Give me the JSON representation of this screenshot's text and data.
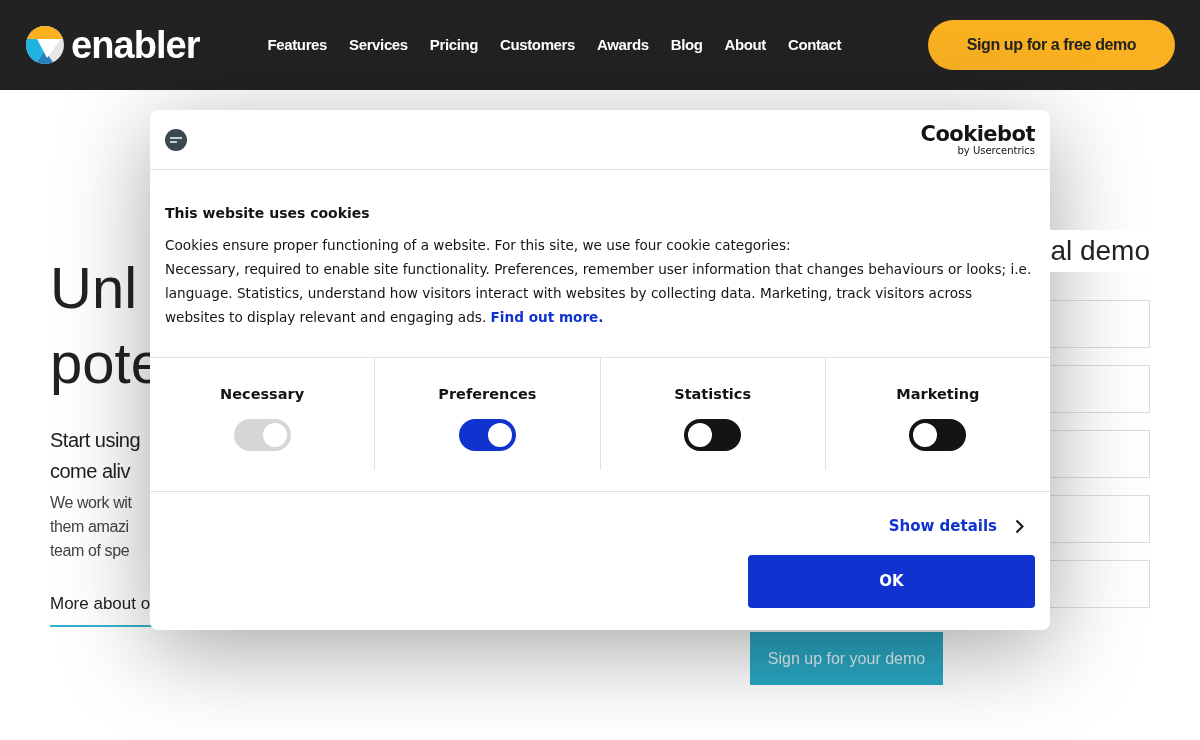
{
  "header": {
    "brand": "enabler",
    "nav": [
      {
        "label": "Features"
      },
      {
        "label": "Services"
      },
      {
        "label": "Pricing"
      },
      {
        "label": "Customers"
      },
      {
        "label": "Awards"
      },
      {
        "label": "Blog"
      },
      {
        "label": "About"
      },
      {
        "label": "Contact"
      }
    ],
    "cta": "Sign up for a free demo"
  },
  "page": {
    "headline_lines": [
      "Unl",
      "pote"
    ],
    "subhead_lines": [
      "Start using",
      "come aliv"
    ],
    "body_lines": [
      "We work wit",
      "them amazi",
      "team of spe"
    ],
    "link": "More about o",
    "form_title": "al demo",
    "submit": "Sign up for your demo"
  },
  "cookie_dialog": {
    "provider": "Cookiebot",
    "provider_sub": "by Usercentrics",
    "title": "This website uses cookies",
    "body": "Cookies ensure proper functioning of a website. For this site, we use four cookie categories:\nNecessary, required to enable site functionality. Preferences, remember user information that changes behaviours or looks; i.e. language. Statistics, understand how visitors interact with websites by collecting data. Marketing, track visitors across websites to display relevant and engaging ads.",
    "link": "Find out more.",
    "categories": [
      {
        "label": "Necessary",
        "checked": true,
        "disabled": true
      },
      {
        "label": "Preferences",
        "checked": true,
        "disabled": false
      },
      {
        "label": "Statistics",
        "checked": false,
        "disabled": false
      },
      {
        "label": "Marketing",
        "checked": false,
        "disabled": false
      }
    ],
    "details": "Show details",
    "ok": "OK"
  }
}
